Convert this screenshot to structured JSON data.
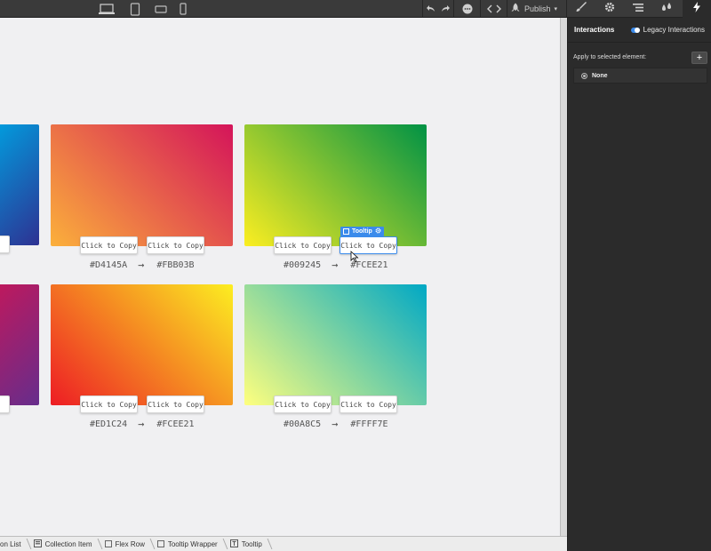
{
  "topbar": {
    "publish_label": "Publish",
    "device_icons": [
      "desktop-icon",
      "tablet-icon",
      "mobile-landscape-icon",
      "mobile-portrait-icon"
    ],
    "panel_tabs": [
      "brush-icon",
      "gear-icon",
      "navigator-icon",
      "drops-icon",
      "lightning-icon"
    ]
  },
  "canvas": {
    "copy_label": "Click to Copy",
    "arrow": "→",
    "selected_badge_label": "Tooltip",
    "cards": [
      {
        "from": "#D4145A",
        "to": "#FBB03B"
      },
      {
        "from": "#009245",
        "to": "#FCEE21"
      },
      {
        "from": "#ED1C24",
        "to": "#FCEE21"
      },
      {
        "from": "#00A8C5",
        "to": "#FFFF7E"
      }
    ]
  },
  "breadcrumb": [
    {
      "label": "on List"
    },
    {
      "label": "Collection Item"
    },
    {
      "label": "Flex Row"
    },
    {
      "label": "Tooltip Wrapper"
    },
    {
      "label": "Tooltip"
    }
  ],
  "panel": {
    "title": "Interactions",
    "legacy_label": "Legacy Interactions",
    "apply_label": "Apply to selected element:",
    "add_label": "+",
    "none_label": "None"
  },
  "colors": {
    "accent": "#3b8beb",
    "panel_bg": "#2b2b2b",
    "canvas_bg": "#f0f0f2"
  }
}
